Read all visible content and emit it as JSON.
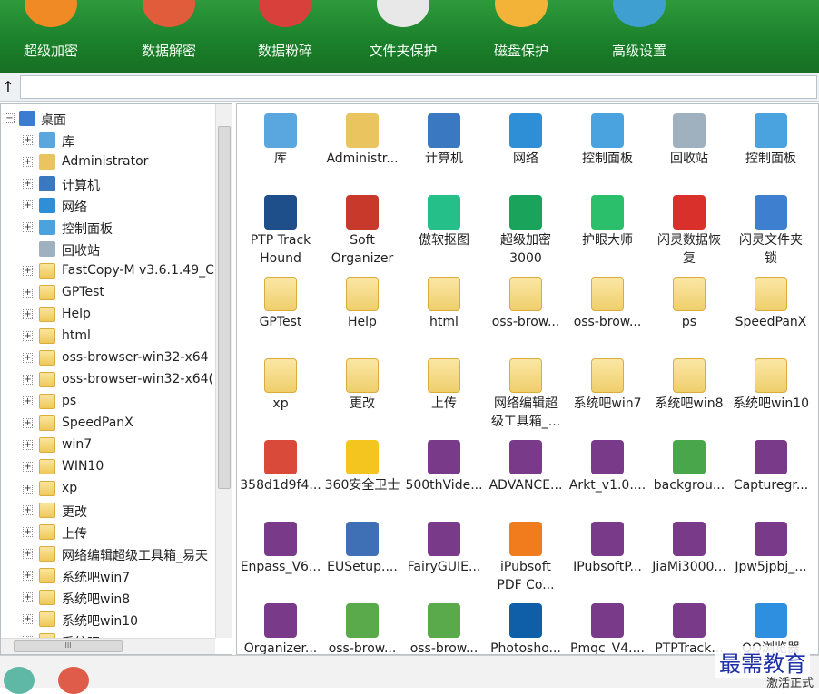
{
  "toolbar": {
    "items": [
      {
        "label": "超级加密",
        "icon": "lock-icon",
        "color": "#f08a24"
      },
      {
        "label": "数据解密",
        "icon": "unlock-icon",
        "color": "#e05c3a"
      },
      {
        "label": "数据粉碎",
        "icon": "shred-icon",
        "color": "#d8403c"
      },
      {
        "label": "文件夹保护",
        "icon": "folder-shield-icon",
        "color": "#e8e8e8"
      },
      {
        "label": "磁盘保护",
        "icon": "disk-shield-icon",
        "color": "#f3b338"
      },
      {
        "label": "高级设置",
        "icon": "gear-icon",
        "color": "#3f9fd0"
      }
    ]
  },
  "address": {
    "up_label": "↑",
    "value": ""
  },
  "tree": {
    "root": "桌面",
    "items": [
      {
        "label": "库",
        "icon": "library-icon"
      },
      {
        "label": "Administrator",
        "icon": "user-folder-icon"
      },
      {
        "label": "计算机",
        "icon": "computer-icon"
      },
      {
        "label": "网络",
        "icon": "network-icon"
      },
      {
        "label": "控制面板",
        "icon": "control-panel-icon"
      },
      {
        "label": "回收站",
        "icon": "recycle-bin-icon"
      },
      {
        "label": "FastCopy-M v3.6.1.49_Cl",
        "icon": "folder-icon"
      },
      {
        "label": "GPTest",
        "icon": "folder-icon"
      },
      {
        "label": "Help",
        "icon": "folder-icon"
      },
      {
        "label": "html",
        "icon": "folder-icon"
      },
      {
        "label": "oss-browser-win32-x64",
        "icon": "folder-icon"
      },
      {
        "label": "oss-browser-win32-x64(",
        "icon": "folder-icon"
      },
      {
        "label": "ps",
        "icon": "folder-icon"
      },
      {
        "label": "SpeedPanX",
        "icon": "folder-icon"
      },
      {
        "label": "win7",
        "icon": "folder-icon"
      },
      {
        "label": "WIN10",
        "icon": "folder-icon"
      },
      {
        "label": "xp",
        "icon": "folder-icon"
      },
      {
        "label": "更改",
        "icon": "folder-icon"
      },
      {
        "label": "上传",
        "icon": "folder-icon"
      },
      {
        "label": "网络编辑超级工具箱_易天",
        "icon": "folder-icon"
      },
      {
        "label": "系统吧win7",
        "icon": "folder-icon"
      },
      {
        "label": "系统吧win8",
        "icon": "folder-icon"
      },
      {
        "label": "系统吧win10",
        "icon": "folder-icon"
      },
      {
        "label": "系统吧",
        "icon": "folder-icon"
      }
    ],
    "hscroll_grip": "III"
  },
  "grid": {
    "items": [
      {
        "label": "库",
        "icon": "library-icon",
        "color": "#5aa7e0"
      },
      {
        "label": "Administr...",
        "icon": "user-folder-icon",
        "color": "#e9c45f"
      },
      {
        "label": "计算机",
        "icon": "computer-icon",
        "color": "#3a78c2"
      },
      {
        "label": "网络",
        "icon": "network-icon",
        "color": "#2f8fd6"
      },
      {
        "label": "控制面板",
        "icon": "control-panel-icon",
        "color": "#4aa3df"
      },
      {
        "label": "回收站",
        "icon": "recycle-bin-icon",
        "color": "#9fb0bf"
      },
      {
        "label": "控制面板",
        "icon": "control-panel-icon",
        "color": "#4aa3df"
      },
      {
        "label": "PTP Track\nHound",
        "icon": "ptp-app-icon",
        "color": "#1f4f8a"
      },
      {
        "label": "Soft\nOrganizer",
        "icon": "puzzle-icon",
        "color": "#c8392b"
      },
      {
        "label": "傲软抠图",
        "icon": "cutout-app-icon",
        "color": "#25c08a"
      },
      {
        "label": "超级加密\n3000",
        "icon": "safe-icon",
        "color": "#1aa35a"
      },
      {
        "label": "护眼大师",
        "icon": "eye-icon",
        "color": "#2bbf6b"
      },
      {
        "label": "闪灵数据恢\n复",
        "icon": "data-recovery-icon",
        "color": "#d9302b"
      },
      {
        "label": "闪灵文件夹\n锁",
        "icon": "folder-lock-icon",
        "color": "#3f7fcf"
      },
      {
        "label": "GPTest",
        "icon": "folder-icon",
        "color": "#efcf6c"
      },
      {
        "label": "Help",
        "icon": "folder-icon",
        "color": "#efcf6c"
      },
      {
        "label": "html",
        "icon": "folder-icon",
        "color": "#efcf6c"
      },
      {
        "label": "oss-brow...",
        "icon": "folder-icon",
        "color": "#efcf6c"
      },
      {
        "label": "oss-brow...",
        "icon": "folder-icon",
        "color": "#efcf6c"
      },
      {
        "label": "ps",
        "icon": "folder-icon",
        "color": "#efcf6c"
      },
      {
        "label": "SpeedPanX",
        "icon": "folder-icon",
        "color": "#efcf6c"
      },
      {
        "label": "xp",
        "icon": "folder-icon",
        "color": "#efcf6c"
      },
      {
        "label": "更改",
        "icon": "folder-icon",
        "color": "#efcf6c"
      },
      {
        "label": "上传",
        "icon": "folder-icon",
        "color": "#efcf6c"
      },
      {
        "label": "网络编辑超\n级工具箱_...",
        "icon": "folder-icon",
        "color": "#efcf6c"
      },
      {
        "label": "系统吧win7",
        "icon": "folder-icon",
        "color": "#efcf6c"
      },
      {
        "label": "系统吧win8",
        "icon": "folder-icon",
        "color": "#efcf6c"
      },
      {
        "label": "系统吧win10",
        "icon": "folder-icon",
        "color": "#efcf6c"
      },
      {
        "label": "358d1d9f4...",
        "icon": "installer-icon",
        "color": "#d94a3a"
      },
      {
        "label": "360安全卫士",
        "icon": "360-security-icon",
        "color": "#f4c51f"
      },
      {
        "label": "500thVide...",
        "icon": "archive-icon",
        "color": "#7a3a8a"
      },
      {
        "label": "ADVANCE...",
        "icon": "archive-icon",
        "color": "#7a3a8a"
      },
      {
        "label": "Arkt_v1.0....",
        "icon": "archive-icon",
        "color": "#7a3a8a"
      },
      {
        "label": "backgrou...",
        "icon": "package-icon",
        "color": "#4aa64a"
      },
      {
        "label": "Capturegr...",
        "icon": "archive-icon",
        "color": "#7a3a8a"
      },
      {
        "label": "Enpass_V6...",
        "icon": "archive-icon",
        "color": "#7a3a8a"
      },
      {
        "label": "EUSetup....",
        "icon": "setup-icon",
        "color": "#3f6fb5"
      },
      {
        "label": "FairyGUIE...",
        "icon": "archive-icon",
        "color": "#7a3a8a"
      },
      {
        "label": "iPubsoft\nPDF Co...",
        "icon": "pdf-icon",
        "color": "#f07c1e"
      },
      {
        "label": "IPubsoftP...",
        "icon": "archive-icon",
        "color": "#7a3a8a"
      },
      {
        "label": "JiaMi3000...",
        "icon": "archive-icon",
        "color": "#7a3a8a"
      },
      {
        "label": "Jpw5jpbj_...",
        "icon": "archive-icon",
        "color": "#7a3a8a"
      },
      {
        "label": "Organizer...",
        "icon": "archive-icon",
        "color": "#7a3a8a"
      },
      {
        "label": "oss-brow...",
        "icon": "oss-app-icon",
        "color": "#5aa94a"
      },
      {
        "label": "oss-brow...",
        "icon": "oss-app-icon",
        "color": "#5aa94a"
      },
      {
        "label": "Photosho...",
        "icon": "photoshop-icon",
        "color": "#0f5fa8"
      },
      {
        "label": "Pmqc_V4....",
        "icon": "archive-icon",
        "color": "#7a3a8a"
      },
      {
        "label": "PTPTrack...",
        "icon": "archive-icon",
        "color": "#7a3a8a"
      },
      {
        "label": "QQ浏览器",
        "icon": "qq-browser-icon",
        "color": "#2e8ee0"
      }
    ]
  },
  "status": {
    "chat_icon": "chat-icon",
    "rocket_icon": "rocket-icon",
    "watermark": "最需教育",
    "activate": "激活正式"
  }
}
